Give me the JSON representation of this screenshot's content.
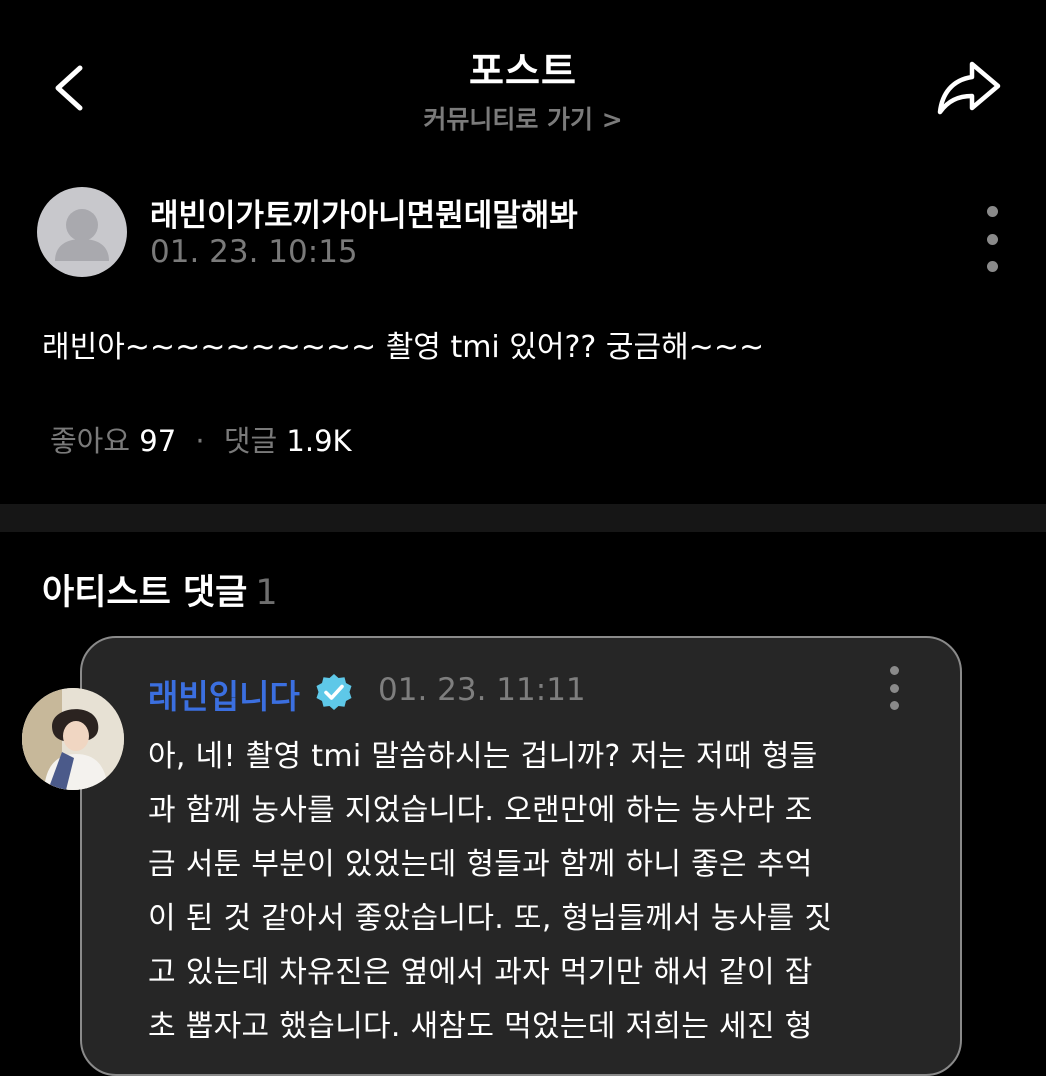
{
  "header": {
    "title": "포스트",
    "community_link": "커뮤니티로 가기 >",
    "back_icon": "chevron-left-icon",
    "share_icon": "share-arrow-icon"
  },
  "post": {
    "author": "래빈이가토끼가아니면뭔데말해봐",
    "date": "01. 23. 10:15",
    "body": "래빈아~~~~~~~~~~ 촬영 tmi 있어?? 궁금해~~~",
    "likes_label": "좋아요",
    "likes_count": "97",
    "comments_label": "댓글",
    "comments_count": "1.9K",
    "separator": "·"
  },
  "artist_comments": {
    "title": "아티스트 댓글",
    "count": "1",
    "comment": {
      "author": "래빈입니다",
      "date": "01. 23. 11:11",
      "lines": [
        "아, 네! 촬영 tmi 말씀하시는 겁니까? 저는 저때 형들",
        "과 함께 농사를 지었습니다. 오랜만에 하는 농사라 조",
        "금 서툰 부분이 있었는데 형들과 함께 하니 좋은 추억",
        "이 된 것 같아서 좋았습니다. 또, 형님들께서 농사를 짓",
        "고 있는데 차유진은 옆에서 과자 먹기만 해서 같이 잡",
        "초 뽑자고 했습니다. 새참도 먹었는데 저희는 세진 형"
      ]
    }
  },
  "colors": {
    "background": "#000000",
    "author_accent": "#3b6fe0",
    "verified_badge": "#5ec8e8",
    "card_background": "#262626",
    "muted_text": "#7a7a7a"
  }
}
